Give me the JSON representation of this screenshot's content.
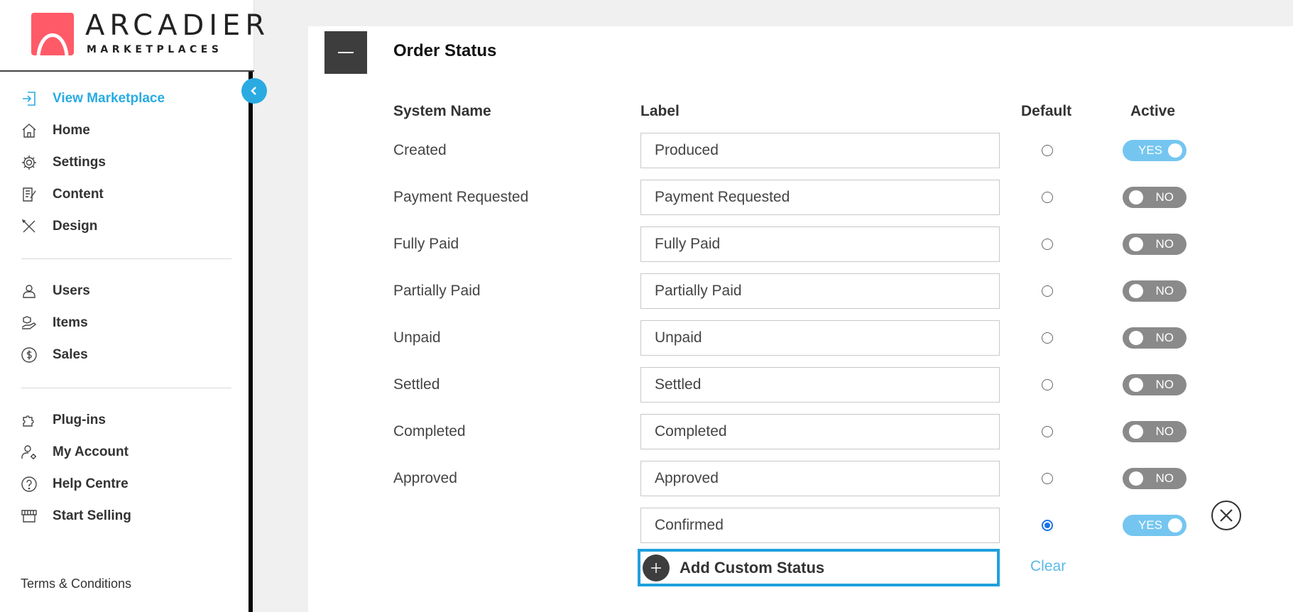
{
  "brand": {
    "name": "ARCADIER",
    "sub": "MARKETPLACES"
  },
  "sidebar": {
    "items": [
      {
        "label": "View Marketplace",
        "icon": "login-arrow-icon"
      },
      {
        "label": "Home",
        "icon": "home-icon"
      },
      {
        "label": "Settings",
        "icon": "gear-icon"
      },
      {
        "label": "Content",
        "icon": "edit-document-icon"
      },
      {
        "label": "Design",
        "icon": "design-tools-icon"
      },
      {
        "label": "Users",
        "icon": "user-icon"
      },
      {
        "label": "Items",
        "icon": "hand-box-icon"
      },
      {
        "label": "Sales",
        "icon": "dollar-circle-icon"
      },
      {
        "label": "Plug-ins",
        "icon": "puzzle-icon"
      },
      {
        "label": "My Account",
        "icon": "user-gear-icon"
      },
      {
        "label": "Help Centre",
        "icon": "question-circle-icon"
      },
      {
        "label": "Start Selling",
        "icon": "storefront-icon"
      }
    ],
    "terms": "Terms & Conditions"
  },
  "panel": {
    "title": "Order Status",
    "columns": {
      "system_name": "System Name",
      "label": "Label",
      "default": "Default",
      "active": "Active"
    },
    "rows": [
      {
        "system_name": "Created",
        "label": "Produced",
        "default": false,
        "active": "YES"
      },
      {
        "system_name": "Payment Requested",
        "label": "Payment Requested",
        "default": false,
        "active": "NO"
      },
      {
        "system_name": "Fully Paid",
        "label": "Fully Paid",
        "default": false,
        "active": "NO"
      },
      {
        "system_name": "Partially Paid",
        "label": "Partially Paid",
        "default": false,
        "active": "NO"
      },
      {
        "system_name": "Unpaid",
        "label": "Unpaid",
        "default": false,
        "active": "NO"
      },
      {
        "system_name": "Settled",
        "label": "Settled",
        "default": false,
        "active": "NO"
      },
      {
        "system_name": "Completed",
        "label": "Completed",
        "default": false,
        "active": "NO"
      },
      {
        "system_name": "Approved",
        "label": "Approved",
        "default": false,
        "active": "NO"
      },
      {
        "system_name": "",
        "label": "Confirmed",
        "default": true,
        "active": "YES"
      }
    ],
    "add_button": "Add Custom Status",
    "clear": "Clear"
  },
  "colors": {
    "accent": "#29abe2",
    "toggle_on": "#74c6f0",
    "toggle_off": "#8a8a8a",
    "brand": "#ff5a67"
  }
}
